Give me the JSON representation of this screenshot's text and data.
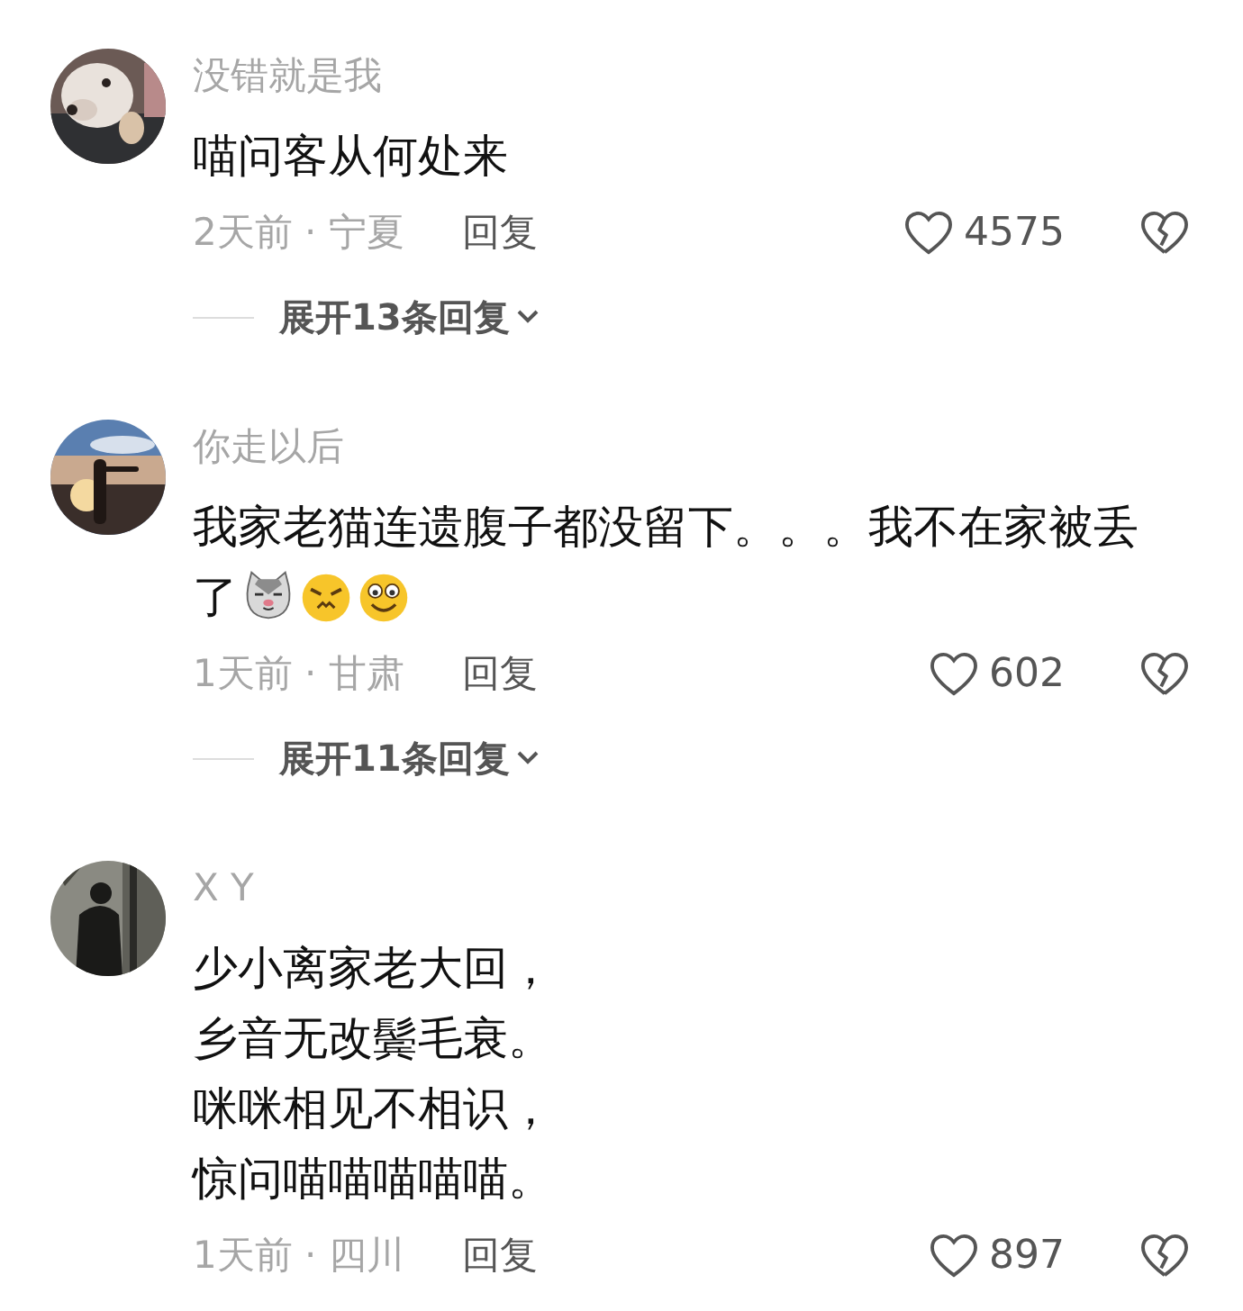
{
  "comments": [
    {
      "avatar": {
        "kind": "picture"
      },
      "name": "没错就是我",
      "lines": [
        "喵问客从何处来"
      ],
      "time_place": "2天前 · 宁夏",
      "reply": "回复",
      "likes": "4575",
      "expand": "展开13条回复"
    },
    {
      "avatar": {
        "kind": "picture"
      },
      "name": "你走以后",
      "lines": [
        "我家老猫连遗腹子都没留下。。。我不在家被丢",
        "了"
      ],
      "emojis": [
        {
          "kind": "cat"
        },
        {
          "kind": "annoyed"
        },
        {
          "kind": "smile"
        }
      ],
      "time_place": "1天前 · 甘肃",
      "reply": "回复",
      "likes": "602",
      "expand": "展开11条回复"
    },
    {
      "avatar": {
        "kind": "picture"
      },
      "name": "X Y",
      "lines": [
        "少小离家老大回，",
        "乡音无改鬓毛衰。",
        "咪咪相见不相识，",
        "惊问喵喵喵喵喵。"
      ],
      "time_place": "1天前 · 四川",
      "reply": "回复",
      "likes": "897"
    }
  ]
}
